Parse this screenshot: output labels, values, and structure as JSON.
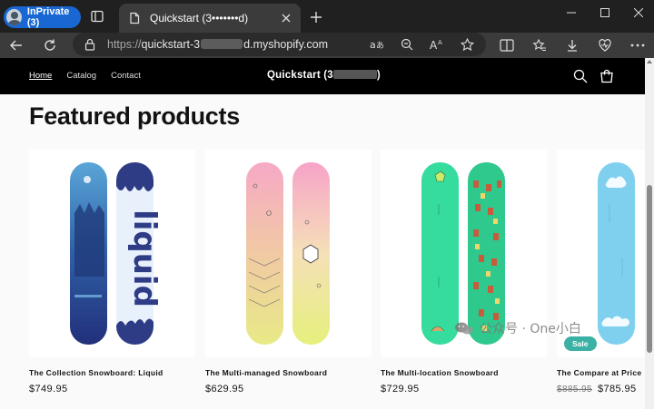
{
  "browser": {
    "inprivate_label": "InPrivate (3)",
    "active_tab": {
      "title": "Quickstart (3•••••••d)",
      "close_icon": "close-icon"
    },
    "new_tab_icon": "plus-icon",
    "window_controls": [
      "minimize-icon",
      "maximize-icon",
      "close-icon"
    ],
    "address": {
      "scheme": "https://",
      "host_prefix": "quickstart-3",
      "host_suffix": "d.myshopify.com"
    },
    "toolbar_icons": [
      "back-icon",
      "refresh-icon",
      "read-aloud-icon",
      "zoom-out-icon",
      "text-size-icon",
      "favorite-star-icon",
      "split-screen-icon",
      "favorites-icon",
      "downloads-icon",
      "browser-essentials-icon",
      "more-icon"
    ]
  },
  "store": {
    "nav": {
      "home": "Home",
      "catalog": "Catalog",
      "contact": "Contact"
    },
    "name_prefix": "Quickstart (3",
    "name_suffix": ")",
    "header_icons": [
      "search-icon",
      "cart-icon"
    ],
    "section_title": "Featured products",
    "products": [
      {
        "name": "The Collection Snowboard: Liquid",
        "price": "$749.95"
      },
      {
        "name": "The Multi-managed Snowboard",
        "price": "$629.95"
      },
      {
        "name": "The Multi-location Snowboard",
        "price": "$729.95"
      },
      {
        "name": "The Compare at Price",
        "compare_price": "$885.95",
        "price": "$785.95",
        "badge": "Sale"
      }
    ]
  },
  "watermark": {
    "text": "公众号 · One小白"
  },
  "colors": {
    "accent": "#1967d2",
    "sale_badge": "#3bb0a5",
    "header_bg": "#000000"
  }
}
